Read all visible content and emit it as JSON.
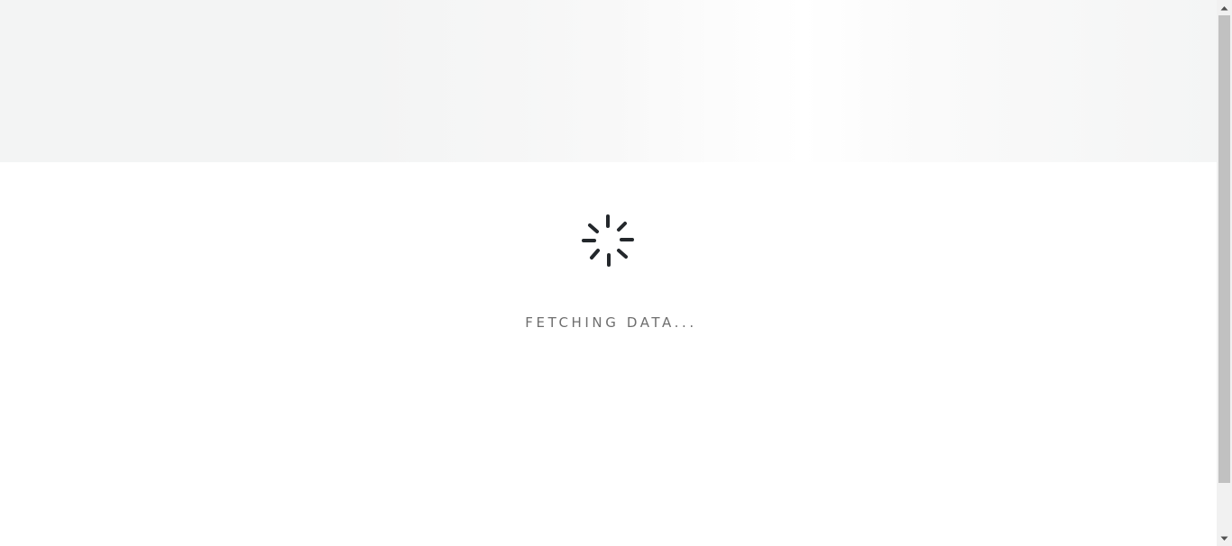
{
  "loading": {
    "message": "FETCHING DATA...",
    "spinner_icon": "spinner-icon",
    "spinner_color": "#23272b"
  },
  "colors": {
    "banner": "#f3f4f4",
    "text": "#6e6e6e",
    "scrollbar_track": "#f1f1f1",
    "scrollbar_thumb": "#c1c1c1"
  },
  "scrollbar": {
    "up_icon": "scroll-up-arrow-icon",
    "down_icon": "scroll-down-arrow-icon"
  }
}
